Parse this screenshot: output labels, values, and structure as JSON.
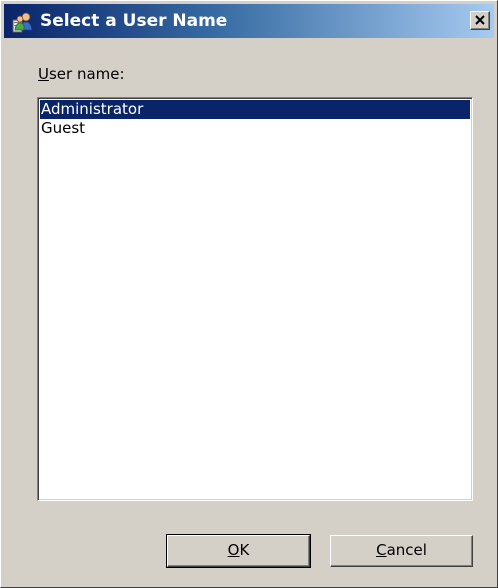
{
  "window": {
    "title": "Select a User Name",
    "titlebar_gradient_start": "#0a246a",
    "titlebar_gradient_end": "#a6caf0"
  },
  "icons": {
    "app": "users-icon",
    "close": "close-icon"
  },
  "field": {
    "label_mnemonic": "U",
    "label_rest": "ser name:"
  },
  "users": {
    "items": [
      "Administrator",
      "Guest"
    ],
    "selected": "Administrator"
  },
  "buttons": {
    "ok_mnemonic": "O",
    "ok_rest": "K",
    "cancel_mnemonic": "C",
    "cancel_rest": "ancel"
  },
  "colors": {
    "selection": "#0a246a",
    "dialog_bg": "#d4d0c8"
  }
}
